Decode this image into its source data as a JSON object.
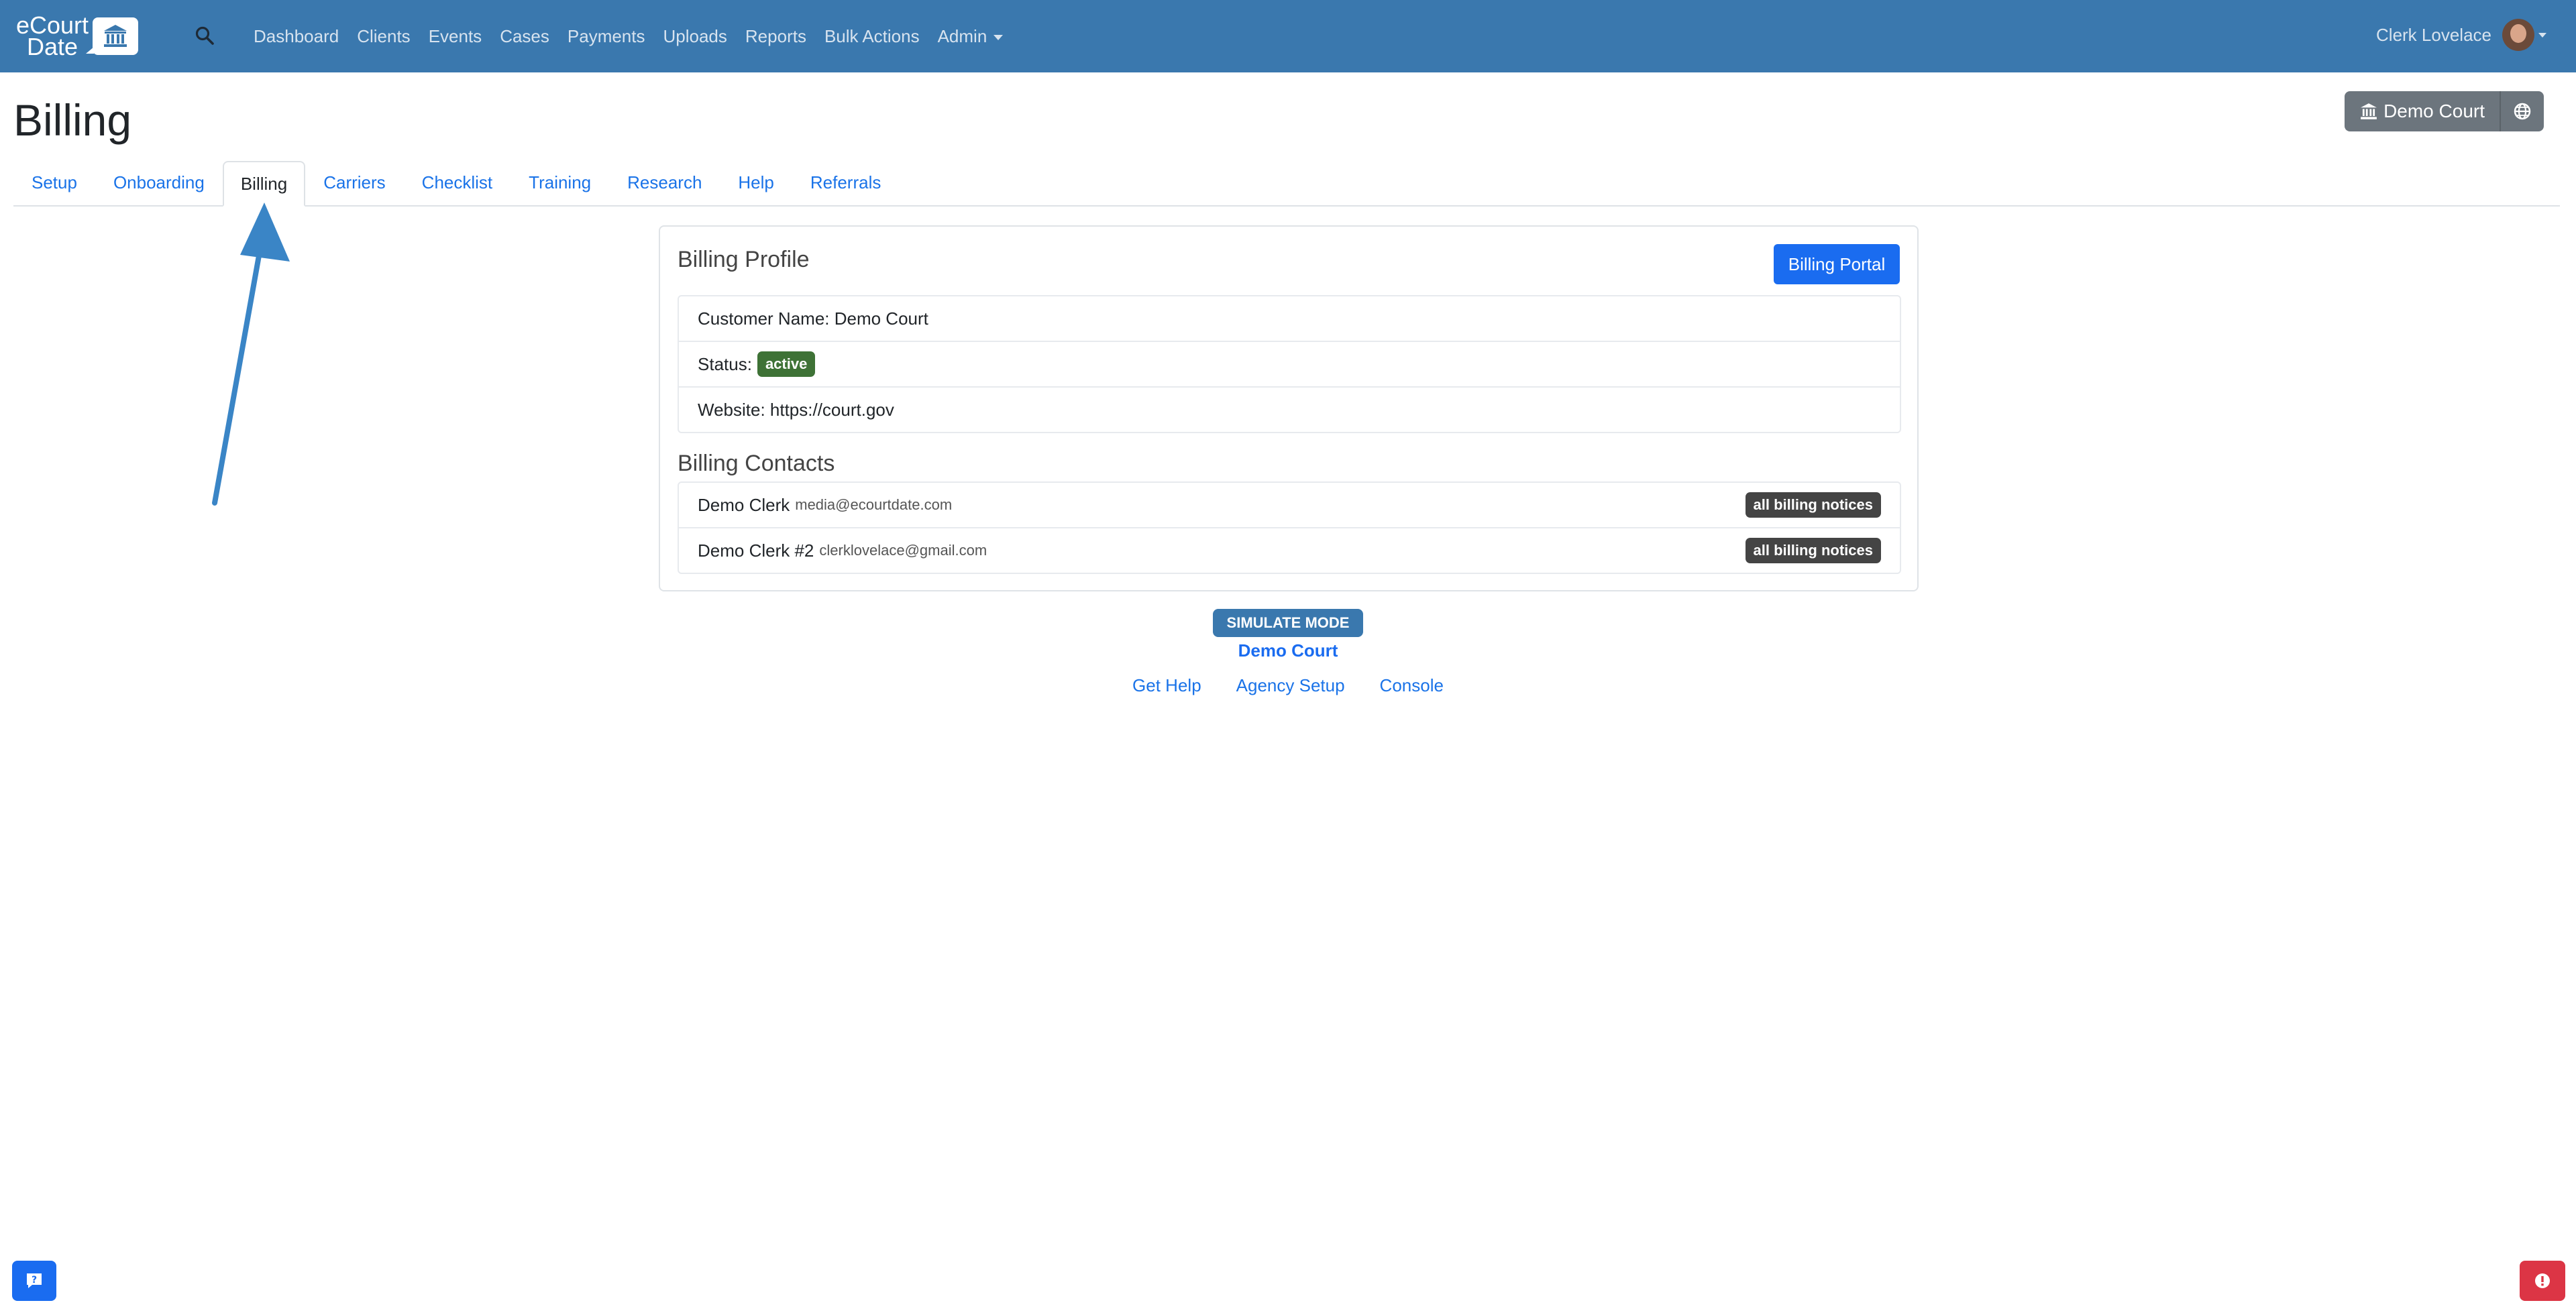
{
  "brand": {
    "line1": "eCourt",
    "line2": "Date"
  },
  "nav": {
    "items": [
      "Dashboard",
      "Clients",
      "Events",
      "Cases",
      "Payments",
      "Uploads",
      "Reports",
      "Bulk Actions"
    ],
    "admin": "Admin"
  },
  "user": {
    "name": "Clerk Lovelace"
  },
  "page": {
    "title": "Billing"
  },
  "court": {
    "button": "Demo Court"
  },
  "tabs": [
    "Setup",
    "Onboarding",
    "Billing",
    "Carriers",
    "Checklist",
    "Training",
    "Research",
    "Help",
    "Referrals"
  ],
  "profile": {
    "title": "Billing Profile",
    "portal_button": "Billing Portal",
    "customer": "Customer Name: Demo Court",
    "status_label": "Status:",
    "status_badge": "active",
    "website": "Website: https://court.gov"
  },
  "contacts": {
    "title": "Billing Contacts",
    "items": [
      {
        "name": "Demo Clerk",
        "email": "media@ecourtdate.com",
        "badge": "all billing notices"
      },
      {
        "name": "Demo Clerk #2",
        "email": "clerklovelace@gmail.com",
        "badge": "all billing notices"
      }
    ]
  },
  "footer": {
    "mode": "SIMULATE MODE",
    "court": "Demo Court",
    "links": [
      "Get Help",
      "Agency Setup",
      "Console"
    ]
  },
  "colors": {
    "navbar": "#3a78ae",
    "primary": "#1a6cf0",
    "success": "#3e7236",
    "danger": "#dc3545",
    "secondary": "#6c757d"
  }
}
